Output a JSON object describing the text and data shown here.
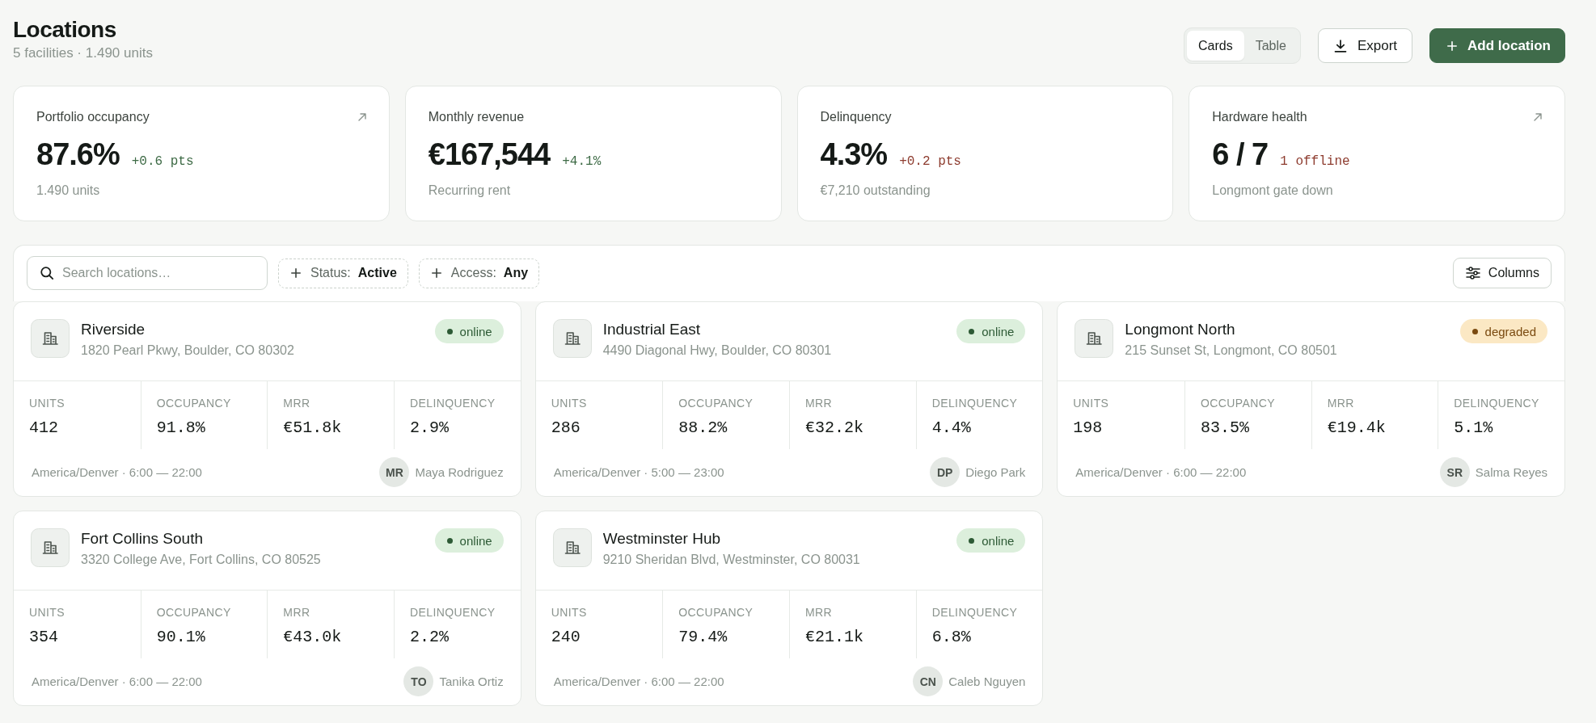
{
  "page": {
    "title": "Locations",
    "subtitle": "5 facilities · 1.490 units"
  },
  "view_toggle": [
    {
      "label": "Cards",
      "selected": true
    },
    {
      "label": "Table",
      "selected": false
    }
  ],
  "actions": [
    {
      "label": "Export",
      "kind": "export"
    },
    {
      "label": "Add location",
      "kind": "add"
    }
  ],
  "kpis": [
    {
      "label": "Portfolio occupancy",
      "value": "87.6%",
      "delta": "+0.6 pts",
      "alert": false,
      "note": "1.490 units",
      "linked": true
    },
    {
      "label": "Monthly revenue",
      "value": "€167,544",
      "delta": "+4.1%",
      "alert": false,
      "note": "Recurring rent",
      "linked": false
    },
    {
      "label": "Delinquency",
      "value": "4.3%",
      "delta": "+0.2 pts",
      "alert": true,
      "note": "€7,210 outstanding",
      "linked": false
    },
    {
      "label": "Hardware health",
      "value": "6 / 7",
      "delta": "1 offline",
      "alert": true,
      "note": "Longmont gate down",
      "linked": true
    }
  ],
  "toolbar": {
    "search": {
      "placeholder": "Search locations…"
    },
    "filters": [
      {
        "label": "Status:",
        "value": "Active"
      },
      {
        "label": "Access:",
        "value": "Any"
      }
    ],
    "columns": {
      "label": "Columns"
    }
  },
  "locations": [
    {
      "name": "Riverside",
      "address": "1820 Pearl Pkwy, Boulder, CO 80302",
      "status": {
        "label": "online",
        "alert": false
      },
      "metrics": [
        {
          "label": "UNITS",
          "value": "412"
        },
        {
          "label": "OCCUPANCY",
          "value": "91.8%"
        },
        {
          "label": "MRR",
          "value": "€51.8k"
        },
        {
          "label": "DELINQUENCY",
          "value": "2.9%"
        }
      ],
      "schedule": "America/Denver · 6:00 — 22:00",
      "manager": {
        "initials": "MR",
        "name": "Maya Rodriguez"
      }
    },
    {
      "name": "Industrial East",
      "address": "4490 Diagonal Hwy, Boulder, CO 80301",
      "status": {
        "label": "online",
        "alert": false
      },
      "metrics": [
        {
          "label": "UNITS",
          "value": "286"
        },
        {
          "label": "OCCUPANCY",
          "value": "88.2%"
        },
        {
          "label": "MRR",
          "value": "€32.2k"
        },
        {
          "label": "DELINQUENCY",
          "value": "4.4%"
        }
      ],
      "schedule": "America/Denver · 5:00 — 23:00",
      "manager": {
        "initials": "DP",
        "name": "Diego Park"
      }
    },
    {
      "name": "Longmont North",
      "address": "215 Sunset St, Longmont, CO 80501",
      "status": {
        "label": "degraded",
        "alert": true
      },
      "metrics": [
        {
          "label": "UNITS",
          "value": "198"
        },
        {
          "label": "OCCUPANCY",
          "value": "83.5%"
        },
        {
          "label": "MRR",
          "value": "€19.4k"
        },
        {
          "label": "DELINQUENCY",
          "value": "5.1%"
        }
      ],
      "schedule": "America/Denver · 6:00 — 22:00",
      "manager": {
        "initials": "SR",
        "name": "Salma Reyes"
      }
    },
    {
      "name": "Fort Collins South",
      "address": "3320 College Ave, Fort Collins, CO 80525",
      "status": {
        "label": "online",
        "alert": false
      },
      "metrics": [
        {
          "label": "UNITS",
          "value": "354"
        },
        {
          "label": "OCCUPANCY",
          "value": "90.1%"
        },
        {
          "label": "MRR",
          "value": "€43.0k"
        },
        {
          "label": "DELINQUENCY",
          "value": "2.2%"
        }
      ],
      "schedule": "America/Denver · 6:00 — 22:00",
      "manager": {
        "initials": "TO",
        "name": "Tanika Ortiz"
      }
    },
    {
      "name": "Westminster Hub",
      "address": "9210 Sheridan Blvd, Westminster, CO 80031",
      "status": {
        "label": "online",
        "alert": false
      },
      "metrics": [
        {
          "label": "UNITS",
          "value": "240"
        },
        {
          "label": "OCCUPANCY",
          "value": "79.4%"
        },
        {
          "label": "MRR",
          "value": "€21.1k"
        },
        {
          "label": "DELINQUENCY",
          "value": "6.8%"
        }
      ],
      "schedule": "America/Denver · 6:00 — 22:00",
      "manager": {
        "initials": "CN",
        "name": "Caleb Nguyen"
      }
    }
  ]
}
